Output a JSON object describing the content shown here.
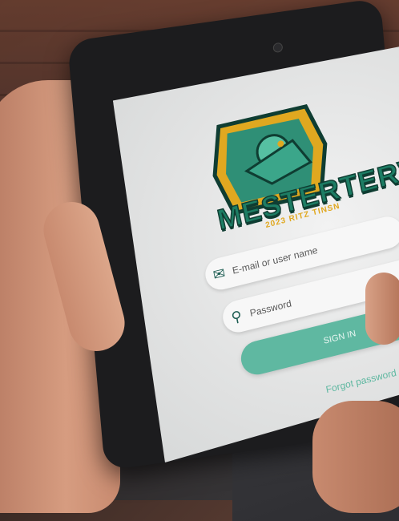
{
  "app": {
    "brand_text": "MESTERTERV",
    "brand_sub": "2023 RITZ TINSN"
  },
  "login": {
    "email_placeholder": "E-mail or user name",
    "password_placeholder": "Password",
    "signin_label": "SIGN IN",
    "forgot_label": "Forgot password"
  },
  "icons": {
    "email": "envelope-icon",
    "password": "key-search-icon"
  },
  "colors": {
    "accent": "#5fb8a1",
    "brand_green": "#1d7d64",
    "brand_gold": "#e0a820"
  }
}
